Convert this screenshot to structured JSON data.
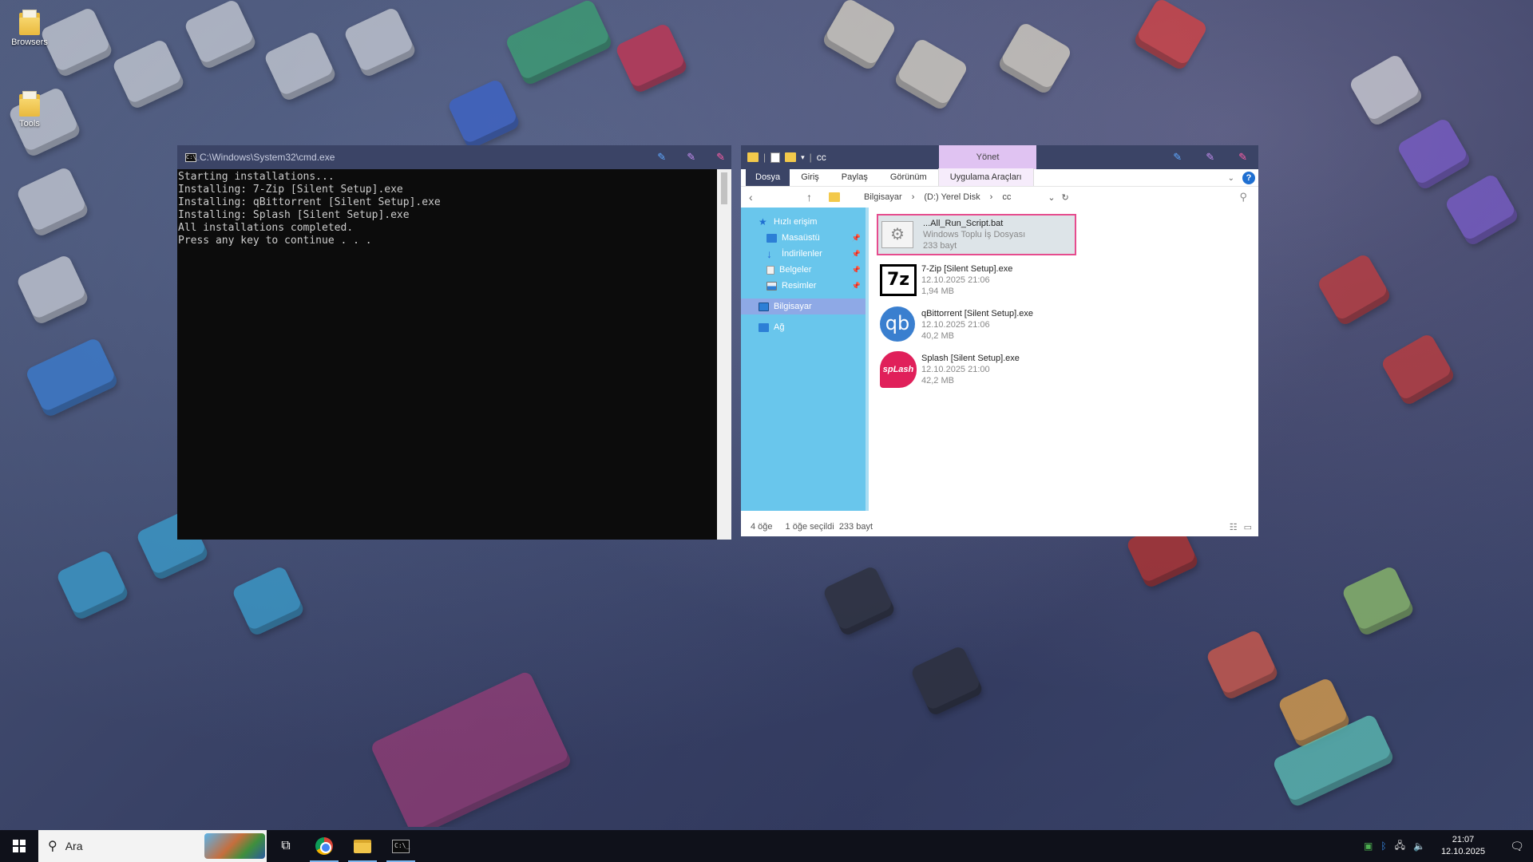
{
  "desktop": {
    "icons": [
      {
        "label": "Browsers"
      },
      {
        "label": "Tools"
      }
    ]
  },
  "cmd": {
    "title": "C:\\Windows\\System32\\cmd.exe",
    "icon_label": "C:\\_",
    "lines": [
      "Starting installations...",
      "Installing: 7-Zip [Silent Setup].exe",
      "Installing: qBittorrent [Silent Setup].exe",
      "Installing: Splash [Silent Setup].exe",
      "All installations completed.",
      "Press any key to continue . . ."
    ]
  },
  "explorer": {
    "title": "cc",
    "contextual_tab": "Yönet",
    "tabs": [
      "Dosya",
      "Giriş",
      "Paylaş",
      "Görünüm"
    ],
    "tools_tab": "Uygulama Araçları",
    "help": "?",
    "address": {
      "crumbs": [
        "Bilgisayar",
        "(D:) Yerel Disk",
        "cc"
      ],
      "separator": "›"
    },
    "nav": [
      {
        "label": "Hızlı erişim",
        "icon": "star-icon"
      },
      {
        "label": "Masaüstü",
        "icon": "desktop-icon"
      },
      {
        "label": "İndirilenler",
        "icon": "download-icon"
      },
      {
        "label": "Belgeler",
        "icon": "documents-icon"
      },
      {
        "label": "Resimler",
        "icon": "pictures-icon"
      },
      {
        "label": "Bilgisayar",
        "icon": "computer-icon"
      },
      {
        "label": "Ağ",
        "icon": "network-icon"
      }
    ],
    "files": [
      {
        "name": "...All_Run_Script.bat",
        "line2": "Windows Toplu İş Dosyası",
        "line3": "233 bayt",
        "icon": "bat-icon"
      },
      {
        "name": "7-Zip [Silent Setup].exe",
        "line2": "12.10.2025 21:06",
        "line3": "1,94 MB",
        "icon": "7zip-icon",
        "glyph": "7z"
      },
      {
        "name": "qBittorrent [Silent Setup].exe",
        "line2": "12.10.2025 21:06",
        "line3": "40,2 MB",
        "icon": "qbittorrent-icon",
        "glyph": "qb"
      },
      {
        "name": "Splash [Silent Setup].exe",
        "line2": "12.10.2025 21:00",
        "line3": "42,2 MB",
        "icon": "splash-icon",
        "glyph": "spLash"
      }
    ],
    "status": {
      "count": "4 öğe",
      "selected": "1 öğe seçildi",
      "size": "233 bayt"
    }
  },
  "taskbar": {
    "search_placeholder": "Ara",
    "time": "21:07",
    "date": "12.10.2025"
  },
  "colors": {
    "title_bar": "#3b4466",
    "nav_pane": "#69c6ec",
    "selection_border": "#e64c8e",
    "contextual_tab": "#e0c3f2"
  }
}
